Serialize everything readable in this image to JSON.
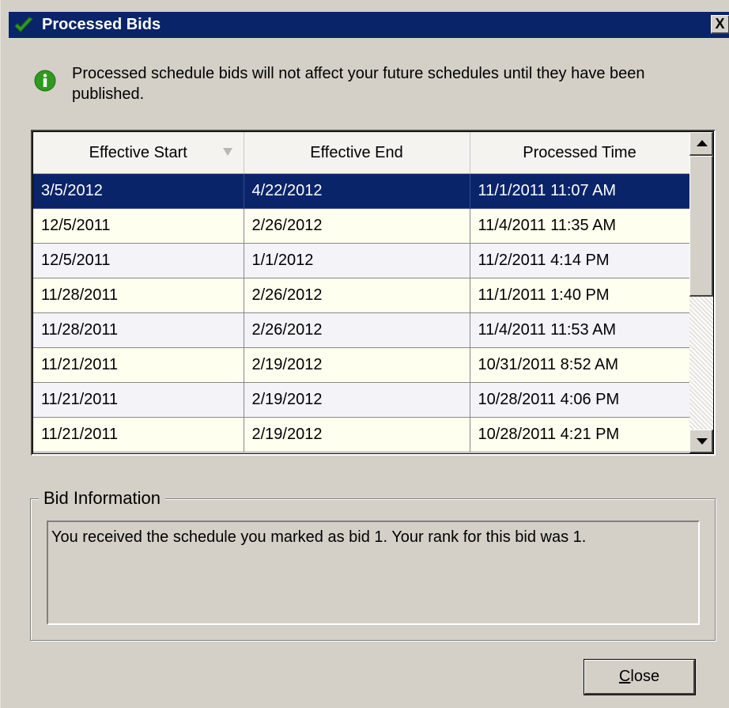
{
  "window": {
    "title": "Processed Bids",
    "close_glyph": "X"
  },
  "info": {
    "message": "Processed schedule bids will not affect your future schedules until they have been published.",
    "icon": "info-icon"
  },
  "grid": {
    "columns": [
      "Effective Start",
      "Effective End",
      "Processed Time"
    ],
    "sort_column": "Effective Start",
    "sort_direction": "descending",
    "rows": [
      {
        "start": "3/5/2012",
        "end": "4/22/2012",
        "processed": "11/1/2011 11:07 AM",
        "selected": true
      },
      {
        "start": "12/5/2011",
        "end": "2/26/2012",
        "processed": "11/4/2011 11:35 AM"
      },
      {
        "start": "12/5/2011",
        "end": "1/1/2012",
        "processed": "11/2/2011 4:14 PM"
      },
      {
        "start": "11/28/2011",
        "end": "2/26/2012",
        "processed": "11/1/2011 1:40 PM"
      },
      {
        "start": "11/28/2011",
        "end": "2/26/2012",
        "processed": "11/4/2011 11:53 AM"
      },
      {
        "start": "11/21/2011",
        "end": "2/19/2012",
        "processed": "10/31/2011 8:52 AM"
      },
      {
        "start": "11/21/2011",
        "end": "2/19/2012",
        "processed": "10/28/2011 4:06 PM"
      },
      {
        "start": "11/21/2011",
        "end": "2/19/2012",
        "processed": "10/28/2011 4:21 PM"
      }
    ]
  },
  "bid_information": {
    "label": "Bid Information",
    "text": "You received the schedule you marked as bid 1. Your rank for this bid was 1."
  },
  "buttons": {
    "close_mnemonic": "C",
    "close_rest": "lose"
  },
  "colors": {
    "titlebar": "#0a246a",
    "window_bg": "#d4d0c8",
    "selected_row": "#0a246a",
    "row_even": "#fffff0",
    "row_odd": "#f3f3f8",
    "checkmark": "#2e9a1e",
    "info_icon": "#2e9a1e"
  }
}
